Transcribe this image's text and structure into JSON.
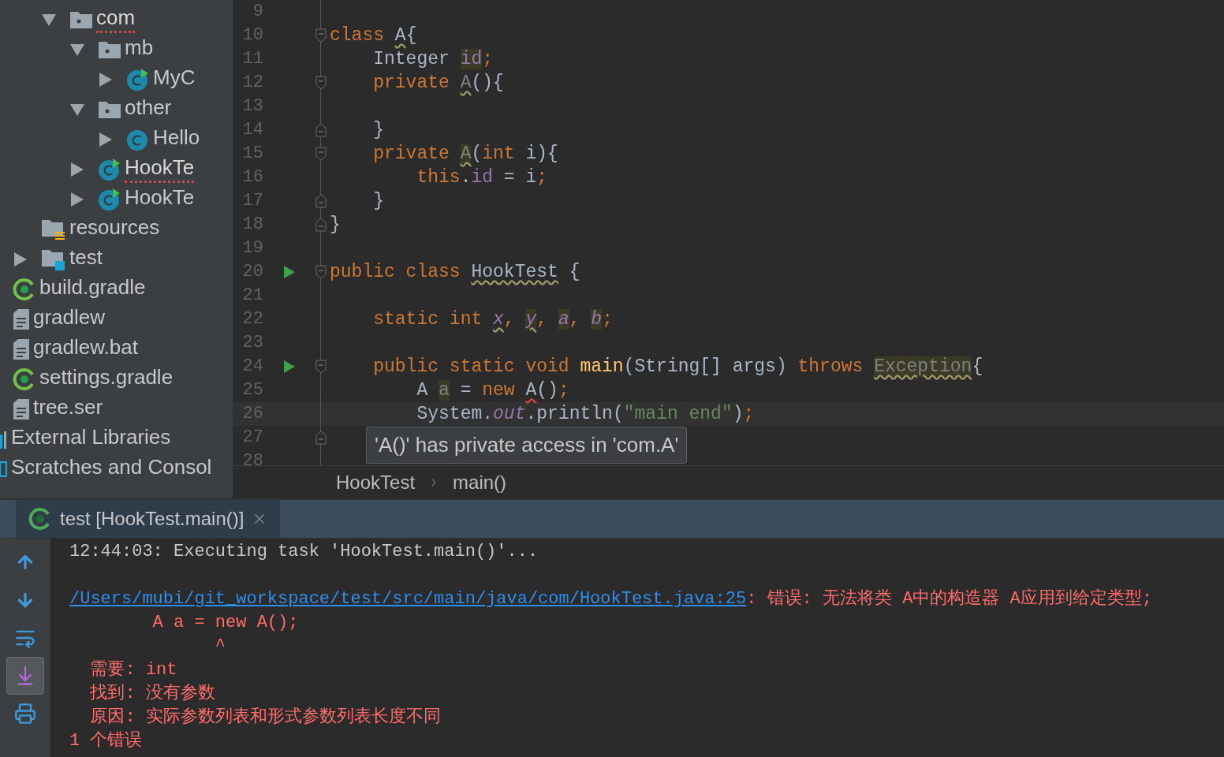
{
  "project_tree": {
    "children": [
      {
        "children": [
          {
            "children": [
              {
                "label": "com",
                "kind": "package",
                "expanded": true,
                "error": true,
                "children": [
                  {
                    "label": "mb",
                    "kind": "package",
                    "expanded": true,
                    "children": [
                      {
                        "label": "MyC",
                        "kind": "class-run",
                        "expanded": false
                      }
                    ]
                  },
                  {
                    "label": "other",
                    "kind": "package",
                    "expanded": true,
                    "children": [
                      {
                        "label": "Hello",
                        "kind": "class",
                        "expanded": false
                      }
                    ]
                  },
                  {
                    "label": "HookTe",
                    "kind": "class-run",
                    "expanded": false,
                    "error": true
                  },
                  {
                    "label": "HookTe",
                    "kind": "class-run",
                    "expanded": false
                  }
                ]
              },
              {
                "label": "resources",
                "kind": "resources"
              }
            ]
          },
          {
            "label": "test",
            "kind": "test-folder",
            "expanded": false
          },
          {
            "label": "build.gradle",
            "kind": "gradle"
          },
          {
            "label": "gradlew",
            "kind": "file"
          },
          {
            "label": "gradlew.bat",
            "kind": "file"
          },
          {
            "label": "settings.gradle",
            "kind": "gradle"
          },
          {
            "label": "tree.ser",
            "kind": "file"
          }
        ]
      },
      {
        "label": "External Libraries",
        "kind": "libraries"
      },
      {
        "label": "Scratches and Consol",
        "kind": "scratches"
      }
    ]
  },
  "editor": {
    "lines": [
      {
        "number": "9"
      },
      {
        "number": "10",
        "fold_start": true,
        "tokens": [
          {
            "t": "class ",
            "kind": "kw"
          },
          {
            "t": "A",
            "kind": "plain",
            "warning": true
          },
          {
            "t": "{",
            "kind": "plain"
          }
        ]
      },
      {
        "number": "11",
        "tokens": [
          {
            "t": "    Integer ",
            "kind": "plain"
          },
          {
            "t": "id",
            "kind": "field",
            "hl": true
          },
          {
            "t": ";",
            "kind": "kw"
          }
        ]
      },
      {
        "number": "12",
        "fold_start": true,
        "tokens": [
          {
            "t": "    private ",
            "kind": "kw"
          },
          {
            "t": "A",
            "kind": "unused",
            "warning": true
          },
          {
            "t": "(){",
            "kind": "plain"
          }
        ]
      },
      {
        "number": "13"
      },
      {
        "number": "14",
        "fold_end": true,
        "tokens": [
          {
            "t": "    }",
            "kind": "plain"
          }
        ]
      },
      {
        "number": "15",
        "fold_start": true,
        "tokens": [
          {
            "t": "    private ",
            "kind": "kw"
          },
          {
            "t": "A",
            "kind": "unused",
            "hl": true,
            "warning": true
          },
          {
            "t": "(",
            "kind": "plain"
          },
          {
            "t": "int ",
            "kind": "kw"
          },
          {
            "t": "i){",
            "kind": "plain"
          }
        ]
      },
      {
        "number": "16",
        "tokens": [
          {
            "t": "        this",
            "kind": "kw"
          },
          {
            "t": ".",
            "kind": "plain"
          },
          {
            "t": "id",
            "kind": "field"
          },
          {
            "t": " = i",
            "kind": "plain"
          },
          {
            "t": ";",
            "kind": "kw"
          }
        ]
      },
      {
        "number": "17",
        "fold_end": true,
        "tokens": [
          {
            "t": "    }",
            "kind": "plain"
          }
        ]
      },
      {
        "number": "18",
        "fold_end": true,
        "tokens": [
          {
            "t": "}",
            "kind": "plain"
          }
        ]
      },
      {
        "number": "19"
      },
      {
        "number": "20",
        "run": true,
        "fold_start": true,
        "tokens": [
          {
            "t": "public class ",
            "kind": "kw"
          },
          {
            "t": "HookTest",
            "kind": "plain",
            "warning": true
          },
          {
            "t": " {",
            "kind": "plain"
          }
        ]
      },
      {
        "number": "21"
      },
      {
        "number": "22",
        "tokens": [
          {
            "t": "    static int ",
            "kind": "kw"
          },
          {
            "t": "x",
            "kind": "static",
            "warning": true
          },
          {
            "t": ", ",
            "kind": "kw"
          },
          {
            "t": "y",
            "kind": "static",
            "hl": true,
            "warning": true
          },
          {
            "t": ", ",
            "kind": "kw"
          },
          {
            "t": "a",
            "kind": "static",
            "hl": true
          },
          {
            "t": ", ",
            "kind": "kw"
          },
          {
            "t": "b",
            "kind": "static",
            "hl": true
          },
          {
            "t": ";",
            "kind": "kw"
          }
        ]
      },
      {
        "number": "23"
      },
      {
        "number": "24",
        "run": true,
        "fold_start": true,
        "tokens": [
          {
            "t": "    public static void ",
            "kind": "kw"
          },
          {
            "t": "main",
            "kind": "method"
          },
          {
            "t": "(String[] args) ",
            "kind": "plain"
          },
          {
            "t": "throws ",
            "kind": "kw"
          },
          {
            "t": "Exception",
            "kind": "unused",
            "hl": true,
            "warning": true
          },
          {
            "t": "{",
            "kind": "plain"
          }
        ]
      },
      {
        "number": "25",
        "tokens": [
          {
            "t": "        A ",
            "kind": "plain"
          },
          {
            "t": "a",
            "kind": "unused",
            "hl": true
          },
          {
            "t": " = ",
            "kind": "plain"
          },
          {
            "t": "new ",
            "kind": "kw"
          },
          {
            "t": "A",
            "kind": "plain",
            "error": true
          },
          {
            "t": "()",
            "kind": "plain"
          },
          {
            "t": ";",
            "kind": "kw"
          }
        ]
      },
      {
        "number": "26",
        "current": true,
        "tokens": [
          {
            "t": "        System.",
            "kind": "plain"
          },
          {
            "t": "out",
            "kind": "static"
          },
          {
            "t": ".println(",
            "kind": "plain"
          },
          {
            "t": "\"main end\"",
            "kind": "string"
          },
          {
            "t": ")",
            "kind": "plain"
          },
          {
            "t": ";",
            "kind": "kw"
          }
        ]
      },
      {
        "number": "27",
        "fold_end": true
      },
      {
        "number": "28"
      }
    ],
    "tooltip": "'A()' has private access in 'com.A'",
    "breadcrumbs": [
      "HookTest",
      "main()"
    ]
  },
  "run_panel": {
    "tabs": [
      {
        "label": "test [HookTest.main()]",
        "selected": true
      }
    ],
    "toolbar": [
      {
        "kind": "up",
        "selected": false
      },
      {
        "kind": "down",
        "selected": false
      },
      {
        "kind": "wrap",
        "selected": false
      },
      {
        "kind": "scroll-end",
        "selected": true
      },
      {
        "kind": "print",
        "selected": false
      }
    ],
    "console": [
      {
        "kind": "info",
        "text": "12:44:03: Executing task 'HookTest.main()'..."
      },
      {
        "kind": "blank"
      },
      {
        "kind": "error-link",
        "link": "/Users/mubi/git_workspace/test/src/main/java/com/HookTest.java:25",
        "text": ": 错误: 无法将类 A中的构造器 A应用到给定类型;"
      },
      {
        "kind": "error",
        "text": "        A a = new A();"
      },
      {
        "kind": "error",
        "text": "              ^"
      },
      {
        "kind": "error",
        "text": "  需要: int"
      },
      {
        "kind": "error",
        "text": "  找到: 没有参数"
      },
      {
        "kind": "error",
        "text": "  原因: 实际参数列表和形式参数列表长度不同"
      },
      {
        "kind": "error",
        "text": "1 个错误"
      }
    ]
  }
}
